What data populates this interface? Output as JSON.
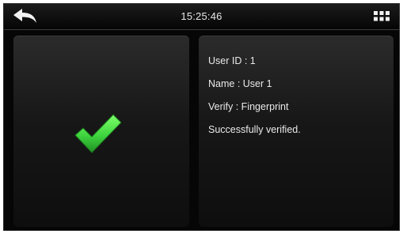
{
  "header": {
    "time": "15:25:46",
    "back_icon": "back-arrow-icon",
    "menu_icon": "grid-menu-icon"
  },
  "result": {
    "status_icon": "checkmark-icon",
    "status_color": "#3fd43f"
  },
  "details": {
    "user_id": "User ID : 1",
    "name": "Name : User 1",
    "verify": "Verify : Fingerprint",
    "message": "Successfully verified."
  }
}
